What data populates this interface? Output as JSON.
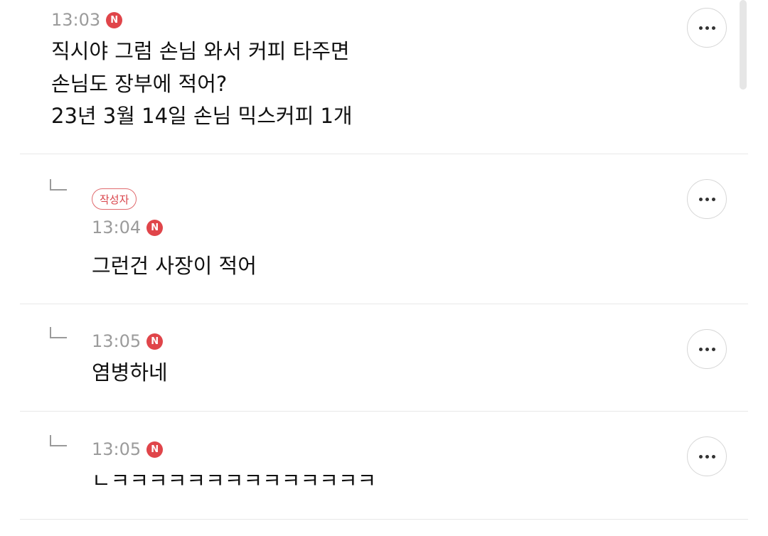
{
  "comments": [
    {
      "time": "13:03",
      "badge": "N",
      "lines": [
        "직시야 그럼 손님 와서 커피 타주면",
        "손님도 장부에 적어?",
        "23년 3월 14일 손님 믹스커피 1개"
      ],
      "more_icon": "more-horizontal-icon"
    },
    {
      "author_label": "작성자",
      "time": "13:04",
      "badge": "N",
      "text": "그런건 사장이 적어",
      "more_icon": "more-horizontal-icon"
    },
    {
      "time": "13:05",
      "badge": "N",
      "text": "염병하네",
      "more_icon": "more-horizontal-icon"
    },
    {
      "time": "13:05",
      "badge": "N",
      "text": "ㄴㅋㅋㅋㅋㅋㅋㅋㅋㅋㅋㅋㅋㅋㅋ",
      "more_icon": "more-horizontal-icon"
    }
  ],
  "colors": {
    "accent_red": "#e0454a",
    "time_gray": "#9b9b9b",
    "divider": "#e8e8e8"
  }
}
